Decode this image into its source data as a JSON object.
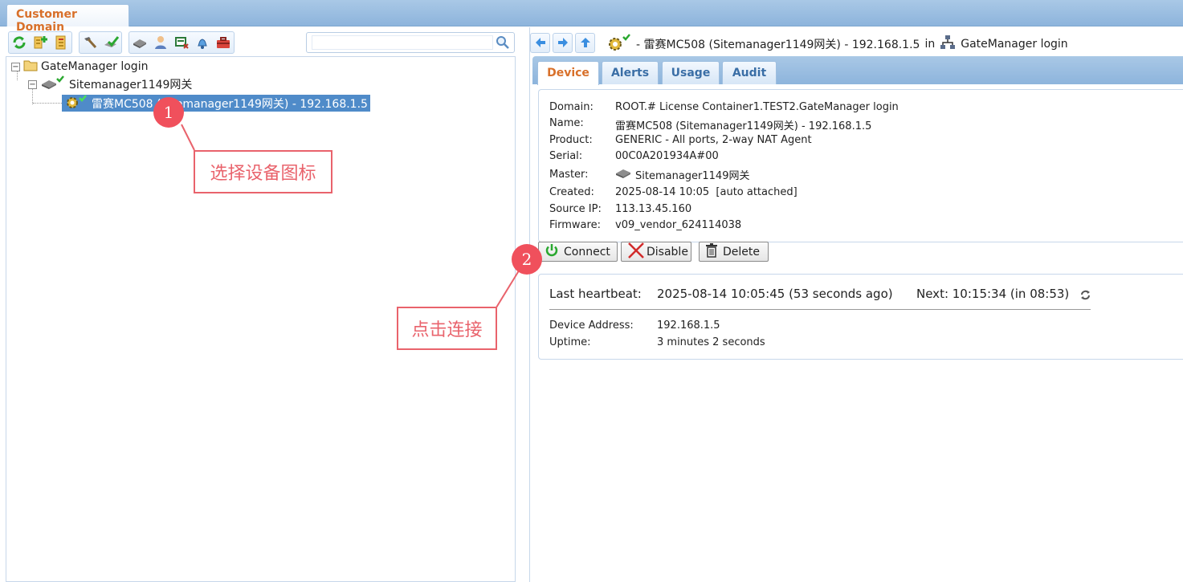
{
  "window": {
    "tab_label": "Customer Domain"
  },
  "search": {
    "placeholder": ""
  },
  "toolbar": {
    "icons": [
      "refresh-icon",
      "add-domain-icon",
      "domain-tree-icon",
      "hammer-icon",
      "approve-icon",
      "appliance-icon",
      "account-icon",
      "alert-flag-icon",
      "bell-icon",
      "toolbox-icon"
    ]
  },
  "tree": {
    "root": "GateManager login",
    "child": "Sitemanager1149网关",
    "device": "雷赛MC508 (Sitemanager1149网关) - 192.168.1.5"
  },
  "breadcrumb": {
    "device": "- 雷赛MC508 (Sitemanager1149网关) - 192.168.1.5",
    "in_word": "in",
    "domain": "GateManager login"
  },
  "tabs": [
    "Device",
    "Alerts",
    "Usage",
    "Audit"
  ],
  "details": {
    "domain_label": "Domain:",
    "domain_value": "ROOT.# License Container1.TEST2.GateManager login",
    "name_label": "Name:",
    "name_value": "雷赛MC508 (Sitemanager1149网关) - 192.168.1.5",
    "product_label": "Product:",
    "product_value": "GENERIC - All ports, 2-way NAT Agent",
    "serial_label": "Serial:",
    "serial_value": "00C0A201934A#00",
    "master_label": "Master:",
    "master_value": "Sitemanager1149网关",
    "created_label": "Created:",
    "created_value": "2025-08-14 10:05  [auto attached]",
    "source_ip_label": "Source IP:",
    "source_ip_value": "113.13.45.160",
    "firmware_label": "Firmware:",
    "firmware_value": "v09_vendor_624114038"
  },
  "actions": {
    "connect": "Connect",
    "disable": "Disable",
    "delete": "Delete"
  },
  "status": {
    "heartbeat_label": "Last heartbeat:",
    "heartbeat_value": "2025-08-14 10:05:45 (53 seconds ago)",
    "next": "Next: 10:15:34 (in 08:53)",
    "address_label": "Device Address:",
    "address_value": "192.168.1.5",
    "uptime_label": "Uptime:",
    "uptime_value": "3 minutes 2 seconds"
  },
  "annotations": {
    "step1_number": "1",
    "step1_text": "选择设备图标",
    "step2_number": "2",
    "step2_text": "点击连接"
  },
  "colors": {
    "accent": "#d8702a",
    "selection": "#4f8bc9",
    "annotation": "#f0505c",
    "ok_check": "#2aa830"
  }
}
